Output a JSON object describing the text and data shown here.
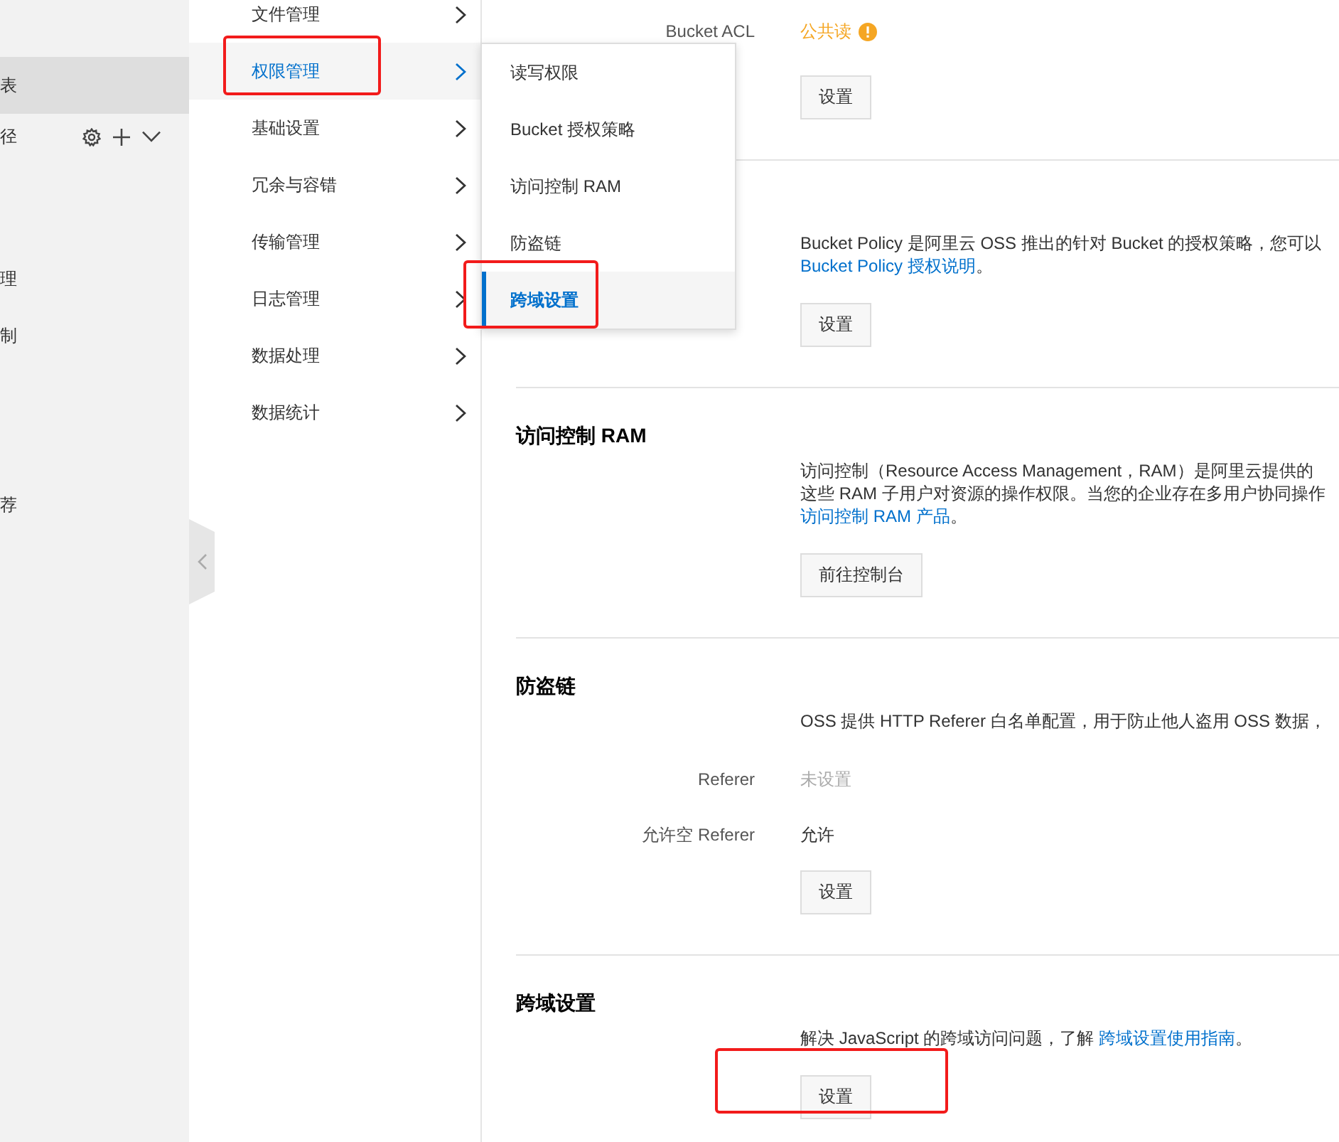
{
  "sidebar": {
    "items": [
      {
        "label": "表",
        "kind": "entry",
        "selected": true
      },
      {
        "label": "径",
        "kind": "header",
        "selected": false
      },
      {
        "label": "理",
        "kind": "entry",
        "selected": false
      },
      {
        "label": "制",
        "kind": "entry",
        "selected": false
      },
      {
        "label": "荐",
        "kind": "entry",
        "selected": false
      }
    ]
  },
  "menu": {
    "items": [
      {
        "label": "文件管理",
        "selected": false,
        "highlight": false
      },
      {
        "label": "权限管理",
        "selected": true,
        "highlight": true
      },
      {
        "label": "基础设置",
        "selected": false,
        "highlight": false
      },
      {
        "label": "冗余与容错",
        "selected": false,
        "highlight": false
      },
      {
        "label": "传输管理",
        "selected": false,
        "highlight": false
      },
      {
        "label": "日志管理",
        "selected": false,
        "highlight": false
      },
      {
        "label": "数据处理",
        "selected": false,
        "highlight": false
      },
      {
        "label": "数据统计",
        "selected": false,
        "highlight": false
      }
    ]
  },
  "submenu": {
    "items": [
      {
        "label": "读写权限",
        "selected": false,
        "highlight": false
      },
      {
        "label": "Bucket 授权策略",
        "selected": false,
        "highlight": false
      },
      {
        "label": "访问控制 RAM",
        "selected": false,
        "highlight": false
      },
      {
        "label": "防盗链",
        "selected": false,
        "highlight": false
      },
      {
        "label": "跨域设置",
        "selected": true,
        "highlight": true
      }
    ]
  },
  "sections": [
    {
      "fields": [
        {
          "label": "Bucket ACL",
          "value": "公共读",
          "color": "#f5a623",
          "warning": true
        }
      ],
      "button": {
        "label": "设置",
        "highlight": false
      }
    },
    {
      "description": [
        [
          {
            "text": "Bucket Policy 是阿里云 OSS 推出的针对 Bucket 的授权策略，您可以"
          }
        ],
        [
          {
            "text": "Bucket Policy 授权说明",
            "kind": "link"
          },
          {
            "text": "。"
          }
        ]
      ],
      "button": {
        "label": "设置",
        "highlight": false
      }
    },
    {
      "title": "访问控制 RAM",
      "description": [
        [
          {
            "text": "访问控制（Resource Access Management，RAM）是阿里云提供的"
          }
        ],
        [
          {
            "text": "这些 RAM 子用户对资源的操作权限。当您的企业存在多用户协同操作"
          }
        ],
        [
          {
            "text": "访问控制 RAM 产品",
            "kind": "link"
          },
          {
            "text": "。"
          }
        ]
      ],
      "button": {
        "label": "前往控制台",
        "highlight": false
      }
    },
    {
      "title": "防盗链",
      "description": [
        [
          {
            "text": "OSS 提供 HTTP Referer 白名单配置，用于防止他人盗用 OSS 数据，"
          }
        ]
      ],
      "fields": [
        {
          "label": "Referer",
          "value": "未设置",
          "color": "#aaaaaa",
          "warning": false
        },
        {
          "label": "允许空 Referer",
          "value": "允许",
          "color": "#333333",
          "warning": false
        }
      ],
      "button": {
        "label": "设置",
        "highlight": false
      }
    },
    {
      "title": "跨域设置",
      "description": [
        [
          {
            "text": "解决 JavaScript 的跨域访问问题，了解 "
          },
          {
            "text": "跨域设置使用指南",
            "kind": "link"
          },
          {
            "text": "。"
          }
        ]
      ],
      "button": {
        "label": "设置",
        "highlight": true
      }
    }
  ]
}
